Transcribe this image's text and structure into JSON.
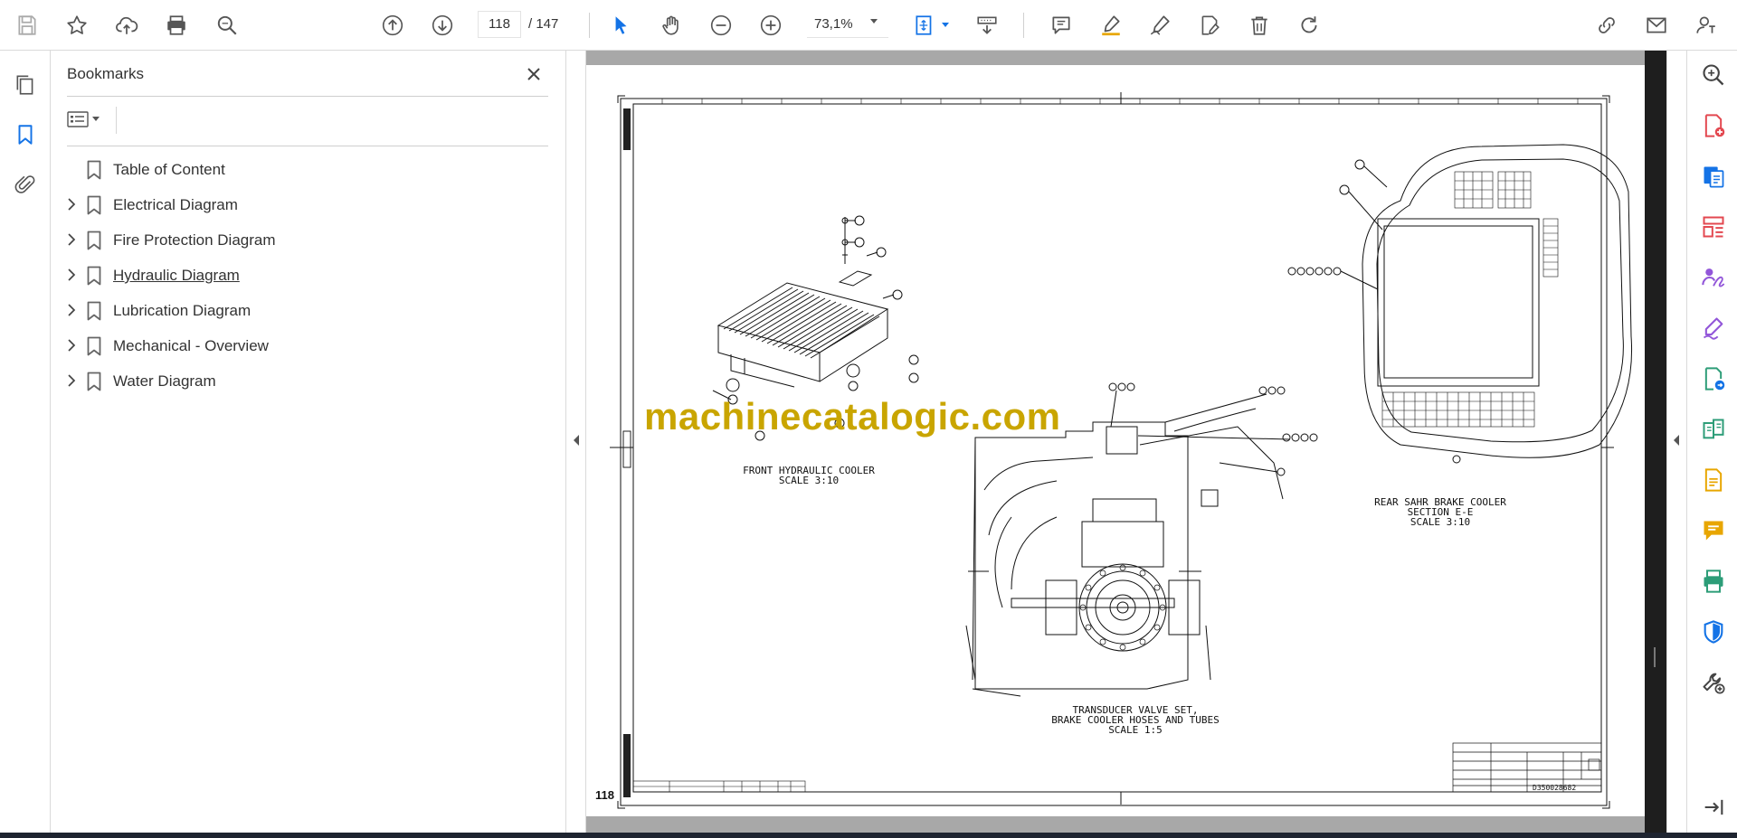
{
  "toolbar": {
    "page_current": "118",
    "page_total": "/ 147",
    "zoom": "73,1%"
  },
  "bookmarks": {
    "title": "Bookmarks",
    "items": [
      {
        "label": "Table of Content",
        "expandable": false
      },
      {
        "label": "Electrical Diagram",
        "expandable": true
      },
      {
        "label": "Fire Protection Diagram",
        "expandable": true
      },
      {
        "label": "Hydraulic Diagram",
        "expandable": true
      },
      {
        "label": "Lubrication Diagram",
        "expandable": true
      },
      {
        "label": "Mechanical - Overview",
        "expandable": true
      },
      {
        "label": "Water Diagram",
        "expandable": true
      }
    ]
  },
  "drawing": {
    "watermark": "machinecatalogic.com",
    "page_number": "118",
    "captions": {
      "front_1": "FRONT HYDRAULIC COOLER",
      "front_2": "SCALE 3:10",
      "rear_1": "REAR SAHR BRAKE COOLER",
      "rear_2": "SECTION E-E",
      "rear_3": "SCALE 3:10",
      "trans_1": "TRANSDUCER VALVE SET,",
      "trans_2": "BRAKE COOLER HOSES AND TUBES",
      "trans_3": "SCALE 1:5"
    },
    "drawing_number": "D350028682"
  },
  "colors": {
    "accent": "#1473e6",
    "watermark": "#c9a500",
    "rail_red": "#e34850",
    "rail_purple": "#9256d9",
    "rail_green": "#2d9d78",
    "rail_yellow": "#e8a600",
    "rail_blue": "#1473e6"
  }
}
